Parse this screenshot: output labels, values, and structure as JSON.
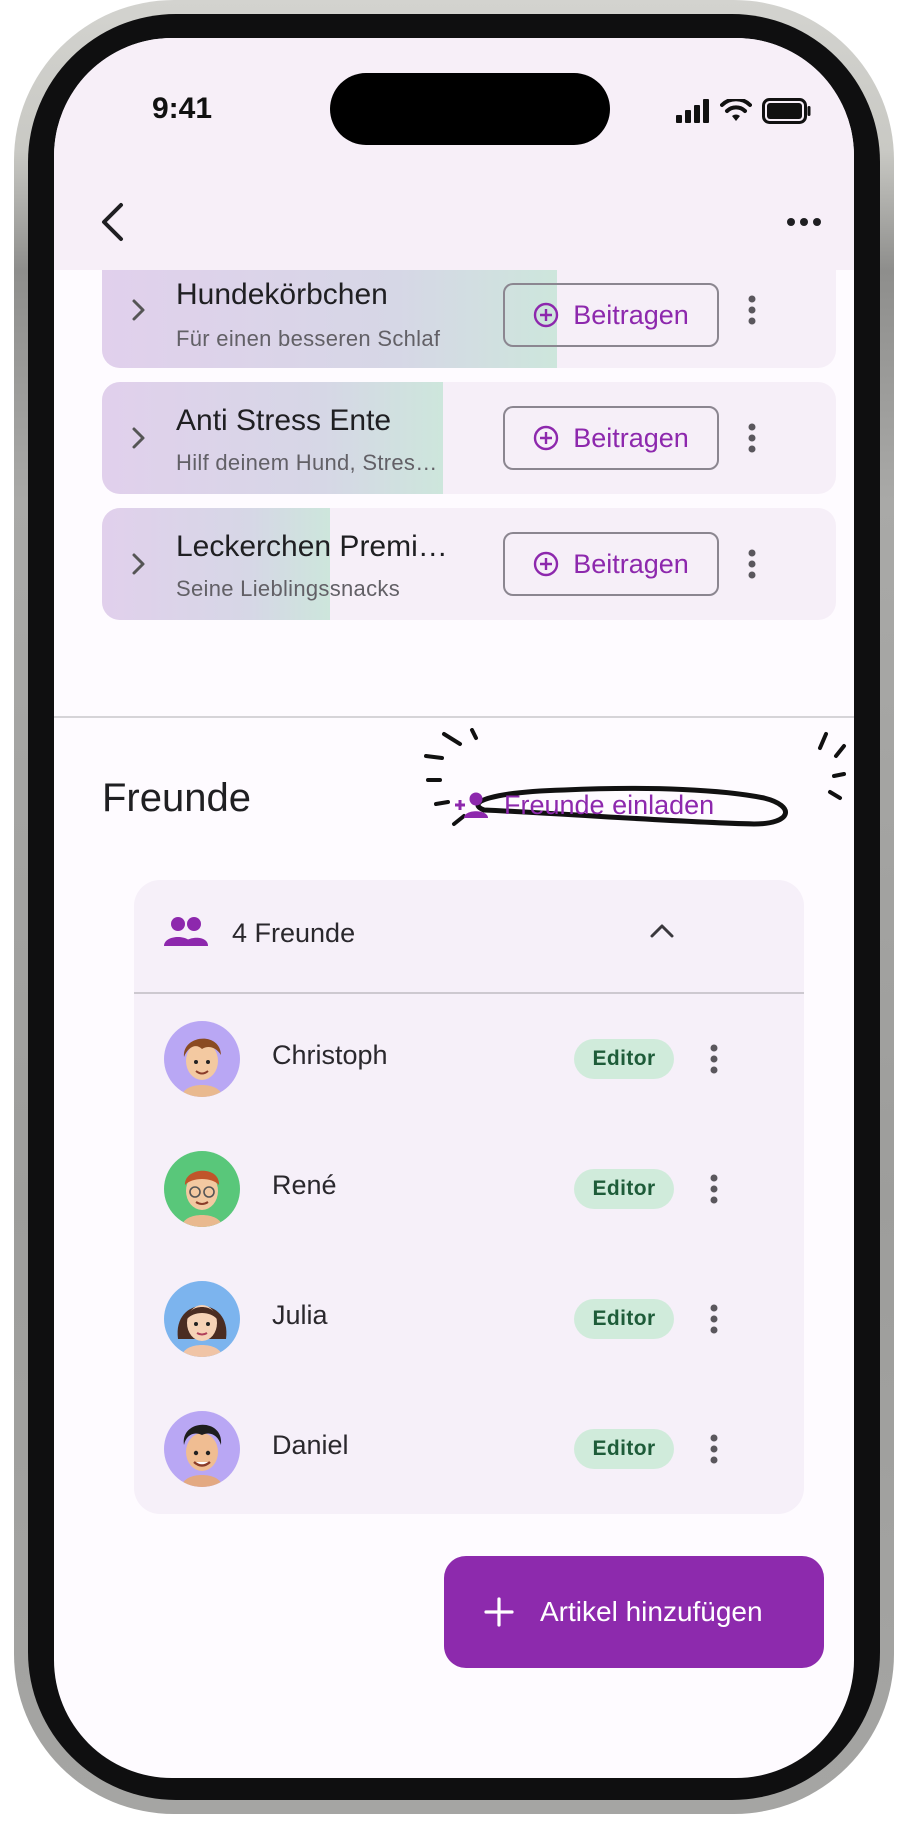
{
  "status_bar": {
    "time": "9:41"
  },
  "contributions": [
    {
      "title": "Hundekörbchen",
      "subtitle": "Für einen besseren Schlaf",
      "button": "Beitragen",
      "progress": 0.62
    },
    {
      "title": "Anti Stress Ente",
      "subtitle": "Hilf deinem Hund, Stres…",
      "button": "Beitragen",
      "progress": 0.465
    },
    {
      "title": "Leckerchen Premi…",
      "subtitle": "Seine Lieblingssnacks",
      "button": "Beitragen",
      "progress": 0.31
    }
  ],
  "friends": {
    "title": "Freunde",
    "invite_label": "Freunde einladen",
    "count_label": "4 Freunde",
    "list": [
      {
        "name": "Christoph",
        "role": "Editor"
      },
      {
        "name": "René",
        "role": "Editor"
      },
      {
        "name": "Julia",
        "role": "Editor"
      },
      {
        "name": "Daniel",
        "role": "Editor"
      }
    ]
  },
  "fab": {
    "label": "Artikel hinzufügen"
  },
  "colors": {
    "accent": "#8d2aad",
    "badge_bg": "#d0ebdb",
    "badge_text": "#1e5c39",
    "surface": "#f6eff8"
  }
}
